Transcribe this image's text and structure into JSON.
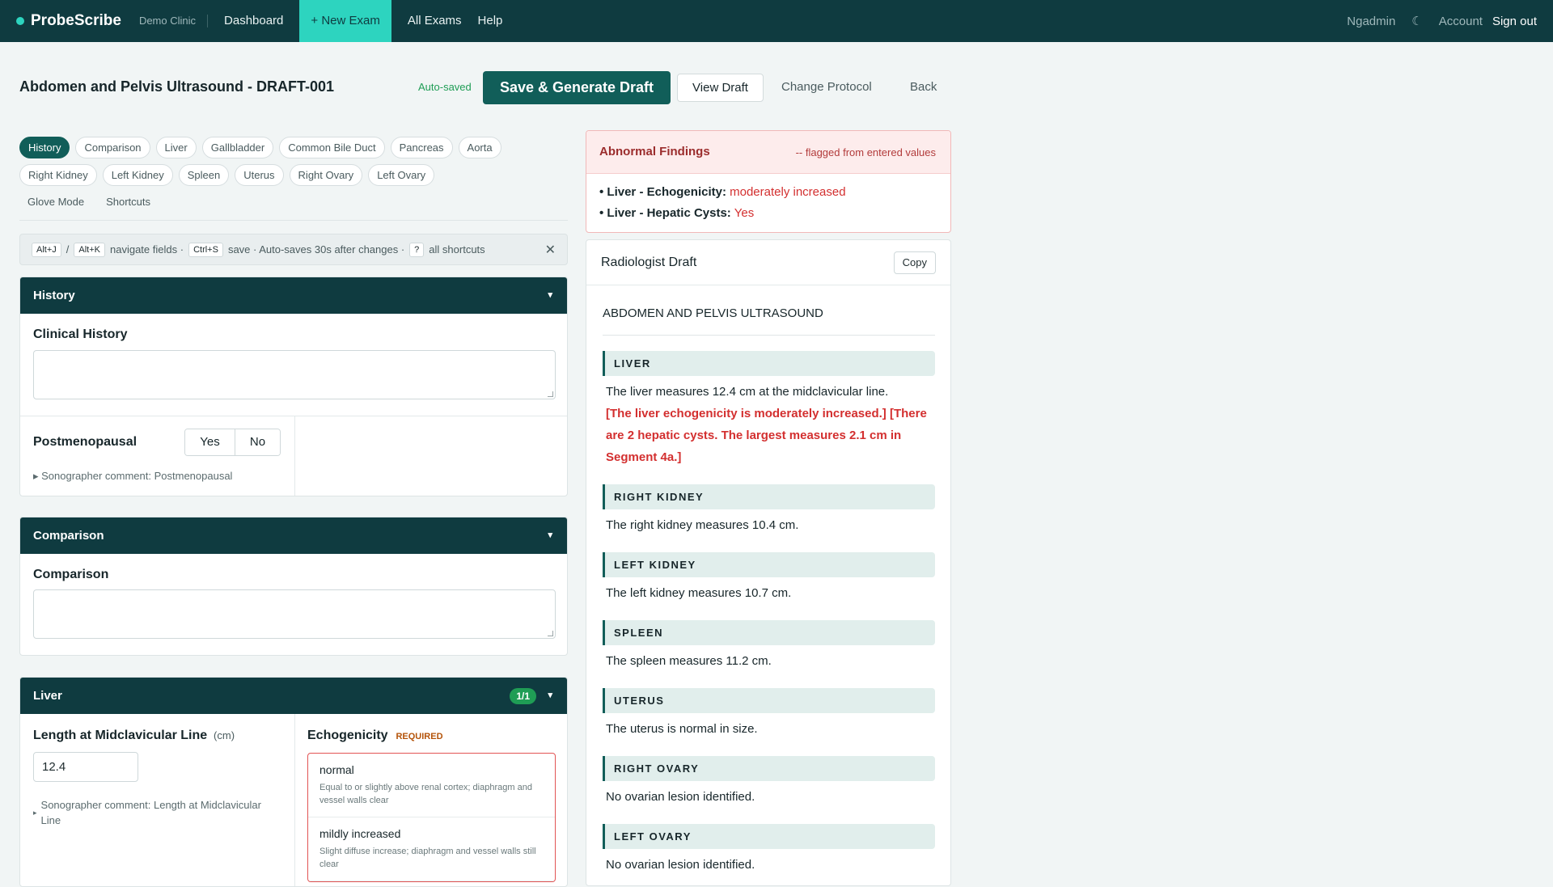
{
  "nav": {
    "logo": "ProbeScribe",
    "clinic": "Demo Clinic",
    "links": [
      "Dashboard",
      "+ New Exam",
      "All Exams",
      "Help"
    ],
    "user": "Ngadmin",
    "theme_icon": "☾",
    "account": "Account",
    "sign_out": "Sign out"
  },
  "header": {
    "title": "Abdomen and Pelvis Ultrasound - DRAFT-001",
    "autosaved": "Auto-saved",
    "save_label": "Save & Generate Draft",
    "view_label": "View Draft",
    "protocol_label": "Change Protocol",
    "back_label": "Back"
  },
  "tabs": {
    "row1": [
      "History",
      "Comparison",
      "Liver",
      "Gallbladder",
      "Common Bile Duct",
      "Pancreas",
      "Aorta"
    ],
    "row2": [
      "Right Kidney",
      "Left Kidney",
      "Spleen",
      "Uterus",
      "Right Ovary",
      "Left Ovary"
    ],
    "row3": [
      "Glove Mode",
      "Shortcuts"
    ]
  },
  "shortcuts": {
    "k1": "Alt+J",
    "sep": "/",
    "k2": "Alt+K",
    "t1": "navigate fields ·",
    "k3": "Ctrl+S",
    "t2": "save · Auto-saves 30s after changes ·",
    "k4": "?",
    "t3": "all shortcuts",
    "close": "✕"
  },
  "history": {
    "title": "History",
    "caret": "▾",
    "clinical_label": "Clinical History",
    "clinical_value": "",
    "postmeno_label": "Postmenopausal",
    "yes": "Yes",
    "no": "No",
    "comment": "▸ Sonographer comment: Postmenopausal"
  },
  "comparison": {
    "title": "Comparison",
    "caret": "▾",
    "label": "Comparison",
    "value": ""
  },
  "liver": {
    "title": "Liver",
    "badge": "1/1",
    "caret": "▾",
    "length_label": "Length at Midclavicular Line",
    "length_unit": "(cm)",
    "length_value": "12.4",
    "comment_arrow": "▸",
    "comment": "Sonographer comment: Length at Midclavicular Line",
    "echo_label": "Echogenicity",
    "required": "REQUIRED",
    "options": [
      {
        "title": "normal",
        "desc": "Equal to or slightly above renal cortex; diaphragm and vessel walls clear"
      },
      {
        "title": "mildly increased",
        "desc": "Slight diffuse increase; diaphragm and vessel walls still clear"
      }
    ]
  },
  "abnormal": {
    "title": "Abnormal Findings",
    "note": "-- flagged from entered values",
    "items": [
      {
        "label": "• Liver - Echogenicity:",
        "value": "moderately increased"
      },
      {
        "label": "• Liver - Hepatic Cysts:",
        "value": "Yes"
      }
    ]
  },
  "draft": {
    "title": "Radiologist Draft",
    "copy": "Copy",
    "exam": "ABDOMEN AND PELVIS ULTRASOUND",
    "liver_head": "LIVER",
    "liver_text": "The liver measures 12.4 cm at the midclavicular line.",
    "liver_flag": "[The liver echogenicity is moderately increased.] [There are 2 hepatic cysts. The largest measures 2.1 cm in Segment 4a.]",
    "rk_head": "RIGHT KIDNEY",
    "rk_text": "The right kidney measures 10.4 cm.",
    "lk_head": "LEFT KIDNEY",
    "lk_text": "The left kidney measures 10.7 cm.",
    "spleen_head": "SPLEEN",
    "spleen_text": "The spleen measures 11.2 cm.",
    "uterus_head": "UTERUS",
    "uterus_text": "The uterus is normal in size.",
    "ro_head": "RIGHT OVARY",
    "ro_text": "No ovarian lesion identified.",
    "lo_head": "LEFT OVARY",
    "lo_text": "No ovarian lesion identified."
  },
  "colors": {
    "nav_bg": "#0f3b40",
    "accent": "#2dd4bf",
    "primary": "#115e59",
    "flag": "#d32f2f",
    "ok": "#1f9d55"
  }
}
